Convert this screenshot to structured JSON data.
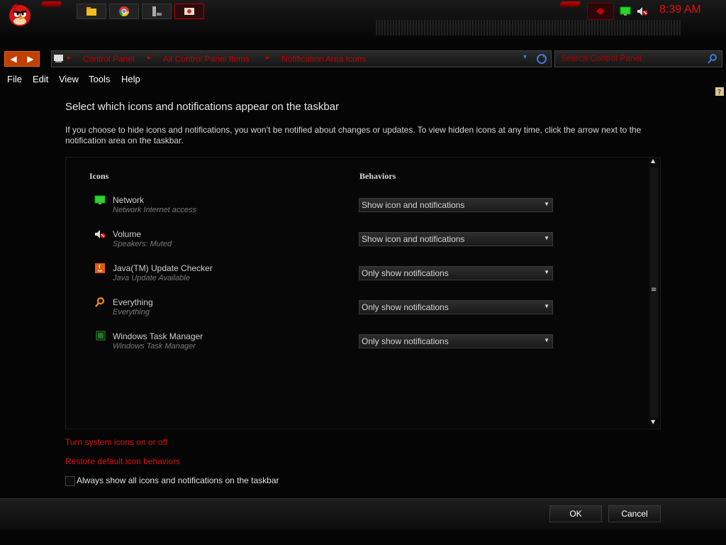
{
  "taskbar": {
    "clock": "8:39 AM",
    "pinned_icons": [
      "explorer-folder-icon",
      "chrome-icon",
      "computer-icon",
      "control-panel-icon"
    ]
  },
  "address_bar": {
    "crumbs": [
      "Control Panel",
      "All Control Panel Items",
      "Notification Area Icons"
    ],
    "search_placeholder": "Search Control Panel"
  },
  "menu": [
    "File",
    "Edit",
    "View",
    "Tools",
    "Help"
  ],
  "main": {
    "heading": "Select which icons and notifications appear on the taskbar",
    "description": "If you choose to hide icons and notifications, you won’t be notified about changes or updates. To view hidden icons at any time, click the arrow next to the notification area on the taskbar.",
    "col_icons": "Icons",
    "col_behaviors": "Behaviors",
    "rows": [
      {
        "name": "Network",
        "sub": "Network Internet access",
        "behavior": "Show icon and notifications",
        "icon": "network-icon"
      },
      {
        "name": "Volume",
        "sub": "Speakers: Muted",
        "behavior": "Show icon and notifications",
        "icon": "volume-muted-icon"
      },
      {
        "name": "Java(TM) Update Checker",
        "sub": "Java Update Available",
        "behavior": "Only show notifications",
        "icon": "java-icon"
      },
      {
        "name": "Everything",
        "sub": "Everything",
        "behavior": "Only show notifications",
        "icon": "search-icon"
      },
      {
        "name": "Windows Task Manager",
        "sub": "Windows Task Manager",
        "behavior": "Only show notifications",
        "icon": "task-manager-icon"
      }
    ]
  },
  "links": {
    "system_icons": "Turn system icons on or off",
    "restore": "Restore default icon behaviors"
  },
  "checkbox": {
    "label": "Always show all icons and notifications on the taskbar",
    "checked": false
  },
  "buttons": {
    "ok": "OK",
    "cancel": "Cancel"
  },
  "colors": {
    "accent_red": "#e01010",
    "background": "#050505"
  }
}
